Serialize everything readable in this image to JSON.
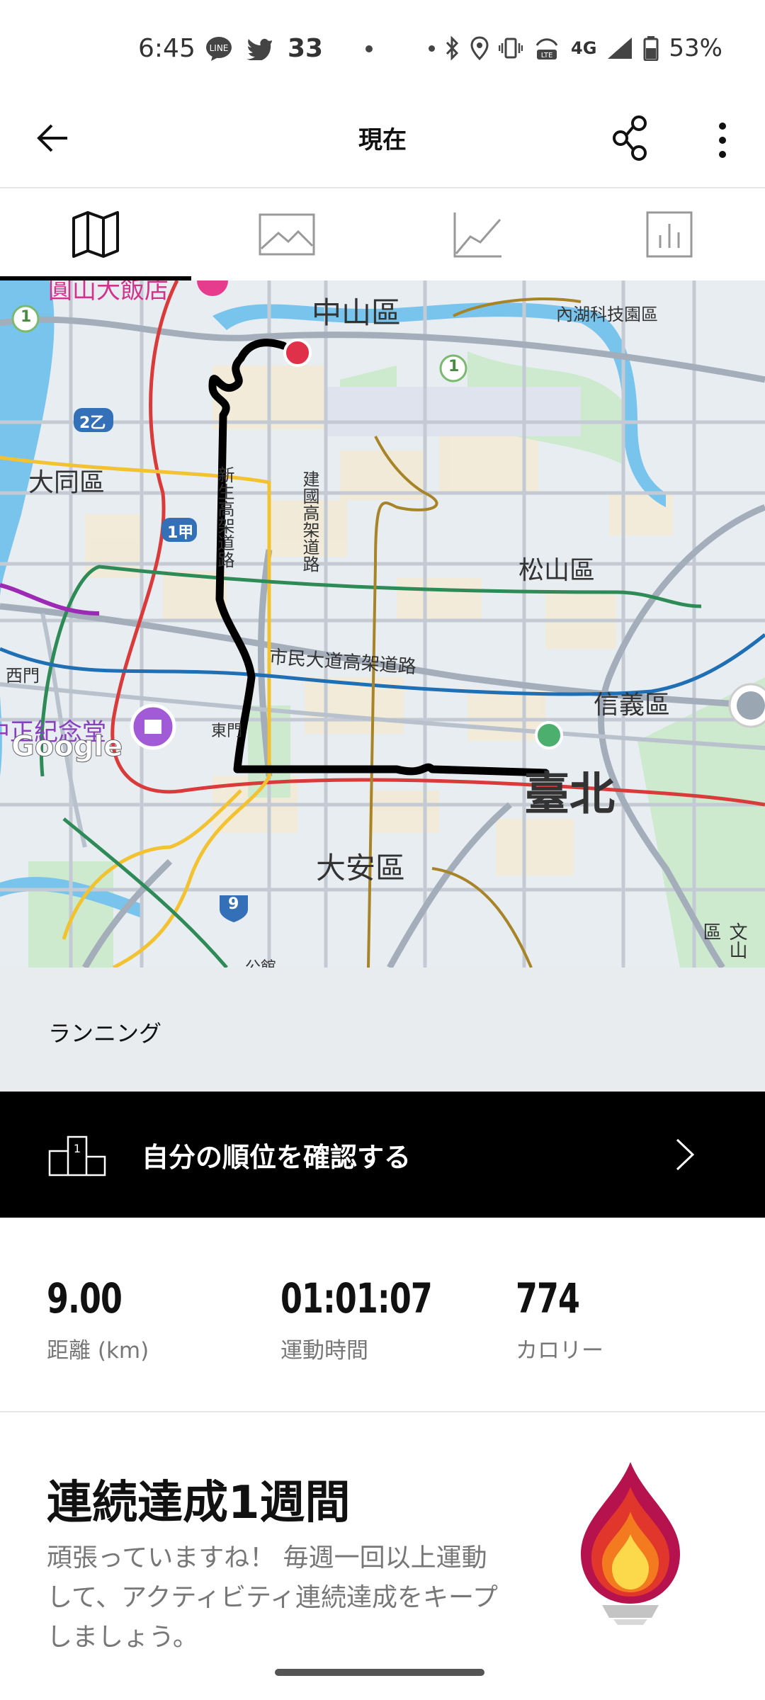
{
  "status_bar": {
    "time": "6:45",
    "notification_count": "33",
    "battery": "53%",
    "network": "4G"
  },
  "app_bar": {
    "title": "現在"
  },
  "tabs": [
    "map-icon",
    "photo-icon",
    "graph-icon",
    "bar-chart-icon"
  ],
  "map": {
    "labels": {
      "zhongshan": "中山區",
      "neihu": "內湖科技園區",
      "datong": "大同區",
      "songshan": "松山區",
      "xinyi": "信義區",
      "daan": "大安區",
      "taipei": "臺北",
      "ximen": "西門",
      "dongmen": "東門",
      "shisheng": "新生高架道路",
      "jianguo": "建國高架道路",
      "civic": "市民大道高架道路",
      "cks": "中正紀念堂",
      "hotel": "圓山大飯店",
      "wenshan": "文山區",
      "gongguan": "公館",
      "road_2a": "2乙",
      "road_1a": "1甲",
      "route_1a": "1",
      "route_1b": "1",
      "route_9": "9",
      "google": "Google"
    }
  },
  "activity": {
    "sport": "ランニング"
  },
  "rank_banner": {
    "label": "自分の順位を確認する"
  },
  "stats": [
    {
      "value": "9.00",
      "label": "距離 (km)"
    },
    {
      "value": "01:01:07",
      "label": "運動時間"
    },
    {
      "value": "774",
      "label": "カロリー"
    }
  ],
  "streak": {
    "title": "連続達成1週間",
    "description": "頑張っていますね！ 毎週一回以上運動して、アクティビティ連続達成をキープしましょう。"
  }
}
